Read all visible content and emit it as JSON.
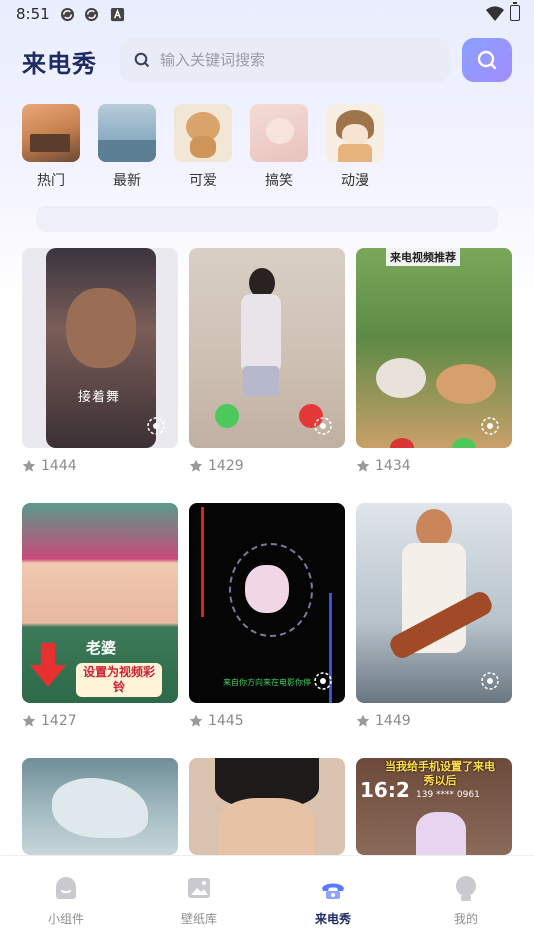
{
  "status_bar": {
    "time": "8:51",
    "icons": [
      "sync-icon",
      "sync-icon",
      "font-a-icon",
      "wifi-icon",
      "battery-icon"
    ]
  },
  "header": {
    "logo": "来电秀",
    "search_placeholder": "输入关键词搜索",
    "search_button_icon": "search-icon"
  },
  "categories": [
    {
      "label": "热门",
      "icon": "thumbnail"
    },
    {
      "label": "最新",
      "icon": "thumbnail"
    },
    {
      "label": "可爱",
      "icon": "thumbnail"
    },
    {
      "label": "搞笑",
      "icon": "thumbnail"
    },
    {
      "label": "动漫",
      "icon": "thumbnail"
    }
  ],
  "grid": {
    "cards": [
      {
        "likes": "1444",
        "overlay_text": "接着舞"
      },
      {
        "likes": "1429",
        "overlay_text": ""
      },
      {
        "likes": "1434",
        "overlay_text": "来电视频推荐"
      },
      {
        "likes": "1427",
        "overlay_text": "老婆",
        "overlay_text_2": "设置为视频彩铃"
      },
      {
        "likes": "1445",
        "overlay_text": "来自你方向来在电影你停"
      },
      {
        "likes": "1449",
        "overlay_text": ""
      },
      {
        "likes": "",
        "overlay_text": ""
      },
      {
        "likes": "",
        "overlay_text": ""
      },
      {
        "likes": "",
        "overlay_text": "当我给手机设置了来电秀以后",
        "overlay_time": "16:2",
        "overlay_number": "139 **** 0961"
      }
    ]
  },
  "nav": {
    "items": [
      {
        "label": "小组件",
        "icon": "widget-icon",
        "active": false
      },
      {
        "label": "壁纸库",
        "icon": "wallpaper-icon",
        "active": false
      },
      {
        "label": "来电秀",
        "icon": "phone-icon",
        "active": true
      },
      {
        "label": "我的",
        "icon": "profile-icon",
        "active": false
      }
    ]
  },
  "colors": {
    "accent": "#1f2b63",
    "search_btn": "#9a95ff",
    "muted": "#8a8a8a"
  }
}
